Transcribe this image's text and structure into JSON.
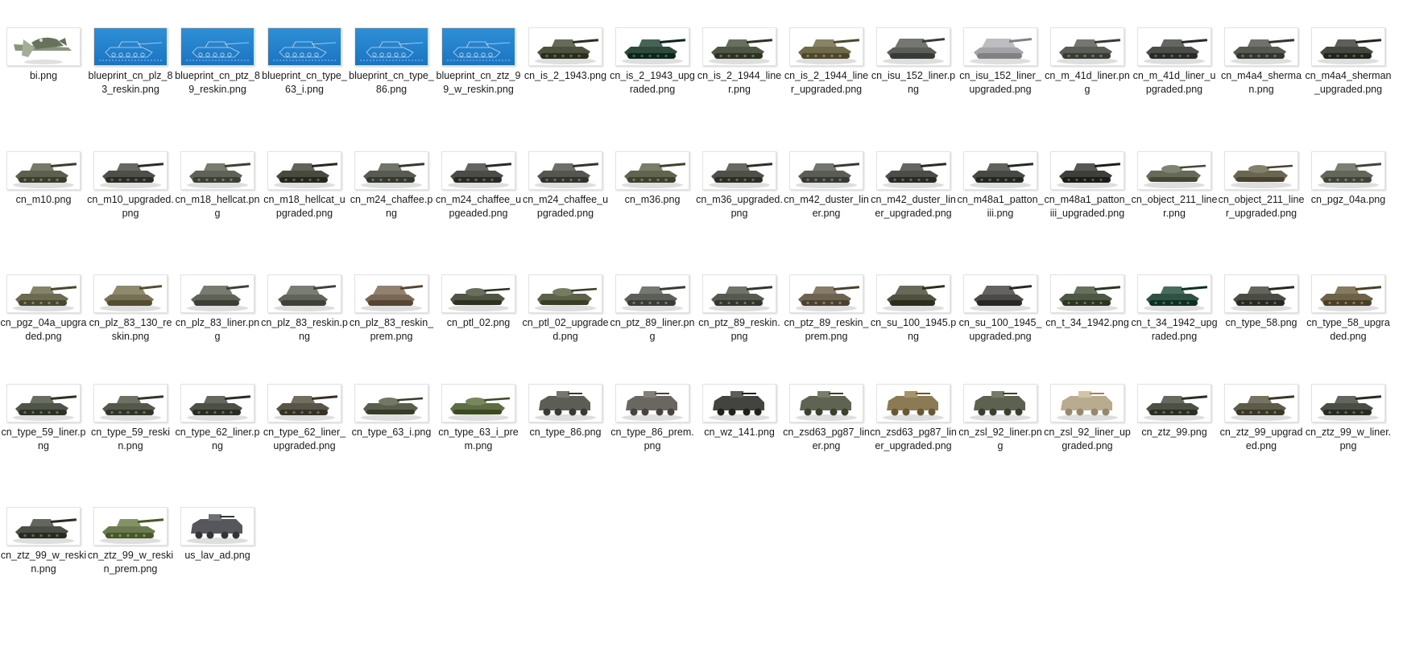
{
  "files": [
    {
      "name": "bi.png",
      "kind": "aircraft",
      "color": "#8b957e"
    },
    {
      "name": "blueprint_cn_plz_83_reskin.png",
      "kind": "blueprint",
      "color": "#1e7bc8"
    },
    {
      "name": "blueprint_cn_ptz_89_reskin.png",
      "kind": "blueprint",
      "color": "#1e7bc8"
    },
    {
      "name": "blueprint_cn_type_63_i.png",
      "kind": "blueprint",
      "color": "#1e7bc8"
    },
    {
      "name": "blueprint_cn_type_86.png",
      "kind": "blueprint",
      "color": "#1e7bc8"
    },
    {
      "name": "blueprint_cn_ztz_99_w_reskin.png",
      "kind": "blueprint",
      "color": "#1e7bc8"
    },
    {
      "name": "cn_is_2_1943.png",
      "kind": "tank",
      "color": "#4d5240"
    },
    {
      "name": "cn_is_2_1943_upgraded.png",
      "kind": "tank",
      "color": "#2e4a3c"
    },
    {
      "name": "cn_is_2_1944_liner.png",
      "kind": "tank",
      "color": "#505646"
    },
    {
      "name": "cn_is_2_1944_liner_upgraded.png",
      "kind": "tank",
      "color": "#6f6a4c"
    },
    {
      "name": "cn_isu_152_liner.png",
      "kind": "spg",
      "color": "#5a5d58"
    },
    {
      "name": "cn_isu_152_liner_upgraded.png",
      "kind": "spg",
      "color": "#a3a3a8"
    },
    {
      "name": "cn_m_41d_liner.png",
      "kind": "tank",
      "color": "#5b5e56"
    },
    {
      "name": "cn_m_41d_liner_upgraded.png",
      "kind": "tank",
      "color": "#4a4d48"
    },
    {
      "name": "cn_m4a4_sherman.png",
      "kind": "tank",
      "color": "#555951"
    },
    {
      "name": "cn_m4a4_sherman_upgraded.png",
      "kind": "tank",
      "color": "#44473f"
    },
    {
      "name": "cn_m10.png",
      "kind": "tank",
      "color": "#5d604f"
    },
    {
      "name": "cn_m10_upgraded.png",
      "kind": "tank",
      "color": "#4e4f48"
    },
    {
      "name": "cn_m18_hellcat.png",
      "kind": "tank",
      "color": "#5f6256"
    },
    {
      "name": "cn_m18_hellcat_upgraded.png",
      "kind": "tank",
      "color": "#48493f"
    },
    {
      "name": "cn_m24_chaffee.png",
      "kind": "tank",
      "color": "#585b52"
    },
    {
      "name": "cn_m24_chaffee_upgeaded.png",
      "kind": "tank",
      "color": "#4b4c47"
    },
    {
      "name": "cn_m24_chaffee_upgraded.png",
      "kind": "tank",
      "color": "#55564f"
    },
    {
      "name": "cn_m36.png",
      "kind": "tank",
      "color": "#61644f"
    },
    {
      "name": "cn_m36_upgraded.png",
      "kind": "tank",
      "color": "#4f5048"
    },
    {
      "name": "cn_m42_duster_liner.png",
      "kind": "tank",
      "color": "#5a5c56"
    },
    {
      "name": "cn_m42_duster_liner_upgraded.png",
      "kind": "tank",
      "color": "#4c4d49"
    },
    {
      "name": "cn_m48a1_patton_iii.png",
      "kind": "tank",
      "color": "#474a44"
    },
    {
      "name": "cn_m48a1_patton_iii_upgraded.png",
      "kind": "tank",
      "color": "#3e3f3b"
    },
    {
      "name": "cn_object_211_liner.png",
      "kind": "low",
      "color": "#666a58"
    },
    {
      "name": "cn_object_211_liner_upgraded.png",
      "kind": "low",
      "color": "#6b6652"
    },
    {
      "name": "cn_pgz_04a.png",
      "kind": "tank",
      "color": "#63665a"
    },
    {
      "name": "cn_pgz_04a_upgraded.png",
      "kind": "tank",
      "color": "#6d6a52"
    },
    {
      "name": "cn_plz_83_130_reskin.png",
      "kind": "spg",
      "color": "#767055"
    },
    {
      "name": "cn_plz_83_liner.png",
      "kind": "spg",
      "color": "#5f6256"
    },
    {
      "name": "cn_plz_83_reskin.png",
      "kind": "spg",
      "color": "#61645a"
    },
    {
      "name": "cn_plz_83_reskin_prem.png",
      "kind": "spg",
      "color": "#7a6857"
    },
    {
      "name": "cn_ptl_02.png",
      "kind": "low",
      "color": "#4f5443"
    },
    {
      "name": "cn_ptl_02_upgraded.png",
      "kind": "low",
      "color": "#5b6248"
    },
    {
      "name": "cn_ptz_89_liner.png",
      "kind": "tank",
      "color": "#5c5f58"
    },
    {
      "name": "cn_ptz_89_reskin.png",
      "kind": "tank",
      "color": "#56594f"
    },
    {
      "name": "cn_ptz_89_reskin_prem.png",
      "kind": "tank",
      "color": "#6e6250"
    },
    {
      "name": "cn_su_100_1945.png",
      "kind": "spg",
      "color": "#4f503f"
    },
    {
      "name": "cn_su_100_1945_upgraded.png",
      "kind": "spg",
      "color": "#4b4a48"
    },
    {
      "name": "cn_t_34_1942.png",
      "kind": "tank",
      "color": "#4e5744"
    },
    {
      "name": "cn_t_34_1942_upgraded.png",
      "kind": "tank",
      "color": "#2f5244"
    },
    {
      "name": "cn_type_58.png",
      "kind": "tank",
      "color": "#4a4c44"
    },
    {
      "name": "cn_type_58_upgraded.png",
      "kind": "tank",
      "color": "#6d6148"
    },
    {
      "name": "cn_type_59_liner.png",
      "kind": "tank",
      "color": "#4f5448"
    },
    {
      "name": "cn_type_59_reskin.png",
      "kind": "tank",
      "color": "#54584a"
    },
    {
      "name": "cn_type_62_liner.png",
      "kind": "tank",
      "color": "#4c4f46"
    },
    {
      "name": "cn_type_62_liner_upgraded.png",
      "kind": "tank",
      "color": "#5a5347"
    },
    {
      "name": "cn_type_63_i.png",
      "kind": "low",
      "color": "#5a5e4c"
    },
    {
      "name": "cn_type_63_i_prem.png",
      "kind": "low",
      "color": "#5f6d45"
    },
    {
      "name": "cn_type_86.png",
      "kind": "apc",
      "color": "#5c5e55"
    },
    {
      "name": "cn_type_86_prem.png",
      "kind": "apc",
      "color": "#6a6660"
    },
    {
      "name": "cn_wz_141.png",
      "kind": "apc",
      "color": "#43443f"
    },
    {
      "name": "cn_zsd63_pg87_liner.png",
      "kind": "apc",
      "color": "#5e6352"
    },
    {
      "name": "cn_zsd63_pg87_liner_upgraded.png",
      "kind": "apc",
      "color": "#8c7a55"
    },
    {
      "name": "cn_zsl_92_liner.png",
      "kind": "apc",
      "color": "#5d6150"
    },
    {
      "name": "cn_zsl_92_liner_upgraded.png",
      "kind": "apc",
      "color": "#b8ab8f"
    },
    {
      "name": "cn_ztz_99.png",
      "kind": "tank",
      "color": "#4d5045"
    },
    {
      "name": "cn_ztz_99_upgraded.png",
      "kind": "tank",
      "color": "#5e5a4a"
    },
    {
      "name": "cn_ztz_99_w_liner.png",
      "kind": "tank",
      "color": "#4a4d43"
    },
    {
      "name": "cn_ztz_99_w_reskin.png",
      "kind": "tank",
      "color": "#4b4e44"
    },
    {
      "name": "cn_ztz_99_w_reskin_prem.png",
      "kind": "tank",
      "color": "#6a7a4e"
    },
    {
      "name": "us_lav_ad.png",
      "kind": "apc",
      "color": "#55575a"
    }
  ]
}
